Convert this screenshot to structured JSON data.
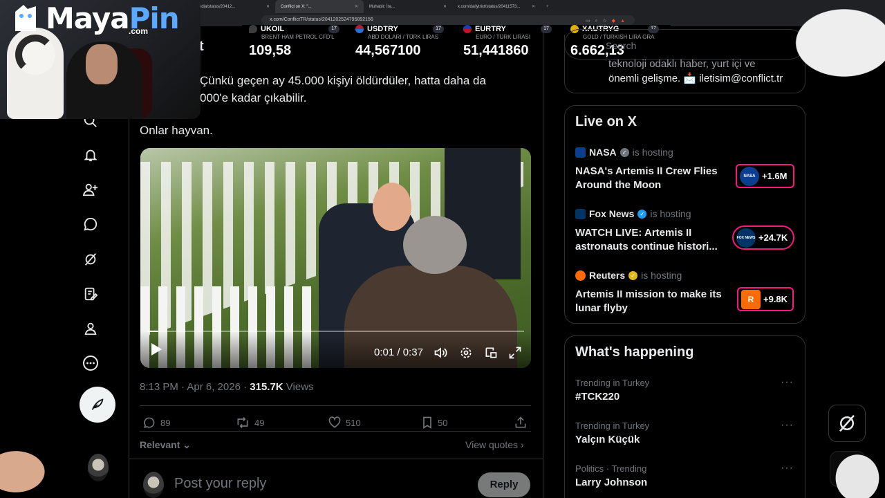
{
  "browser": {
    "tabs": [
      {
        "title": "...Media/status/20412..."
      },
      {
        "title": "Conflict on X: \"...",
        "active": true
      },
      {
        "title": "Muhabir: İra..."
      },
      {
        "title": "x.com/dailytrict/status/20411573..."
      }
    ],
    "url": "x.com/ConflictTR/status/2041202524795892156"
  },
  "ticker": [
    {
      "symbol": "UKOIL",
      "desc": "BRENT HAM PETROL CFD'L",
      "value": "109,58",
      "color": "#3c3c3c"
    },
    {
      "symbol": "USDTRY",
      "desc": "ABD DOLARI / TÜRK LIRAS",
      "value": "44,567100",
      "color": "#2d6fd1"
    },
    {
      "symbol": "EURTRY",
      "desc": "EURO / TÜRK LIRASI",
      "value": "51,441860",
      "color": "#1e3fb0"
    },
    {
      "symbol": "XAUTRYG",
      "desc": "GOLD / TURKISH LIRA GRA",
      "value": "6.662,13",
      "color": "#e0b000"
    }
  ],
  "ticker_badge": "17",
  "header_fragment": "t",
  "tweet": {
    "line1": "Çünkü geçen ay 45.000 kişiyi öldürdüler, hatta daha da",
    "line2": "000'e kadar çıkabilir.",
    "line3": "Onlar hayvan.",
    "video": {
      "current": "0:01",
      "sep": " / ",
      "duration": "0:37",
      "progress": 0.03
    },
    "time": "8:13 PM · Apr 6, 2026 · ",
    "views_count": "315.7K",
    "views_label": " Views",
    "stats": {
      "replies": "89",
      "reposts": "49",
      "likes": "510",
      "bookmarks": "50"
    },
    "sort_label": "Relevant",
    "view_quotes": "View quotes",
    "reply_placeholder": "Post your reply",
    "reply_button": "Reply"
  },
  "sidebar": {
    "search_placeholder": "Search",
    "bio_line1": "teknoloji odaklı haber, yurt içi ve",
    "bio_line2": "önemli gelişme. 📩 iletisim@conflict.tr",
    "live": {
      "title": "Live on X",
      "items": [
        {
          "host": "NASA",
          "hosting": "is hosting",
          "title1": "NASA's Artemis II Crew Flies",
          "title2": "Around the Moon",
          "count": "+1.6M",
          "logo_color": "#0b3d91",
          "badge_color": "#71767b",
          "thumb_text": "NASA"
        },
        {
          "host": "Fox News",
          "hosting": "is hosting",
          "title1": "WATCH LIVE: Artemis II",
          "title2": "astronauts continue histori...",
          "count": "+24.7K",
          "logo_color": "#003366",
          "badge_color": "#1d9bf0",
          "thumb_text": "FOX NEWS"
        },
        {
          "host": "Reuters",
          "hosting": "is hosting",
          "title1": "Artemis II mission to make its",
          "title2": "lunar flyby",
          "count": "+9.8K",
          "logo_color": "#ff6b00",
          "badge_color": "#e2b719",
          "thumb_text": "R"
        }
      ]
    },
    "happening": {
      "title": "What's happening",
      "items": [
        {
          "category": "Trending in Turkey",
          "name": "#TCK220"
        },
        {
          "category": "Trending in Turkey",
          "name": "Yalçın Küçük"
        },
        {
          "category": "Politics · Trending",
          "name": "Larry Johnson"
        }
      ]
    }
  },
  "overlay": {
    "logo_maya": "Maya",
    "logo_pin": "Pin",
    "logo_com": ".com"
  }
}
